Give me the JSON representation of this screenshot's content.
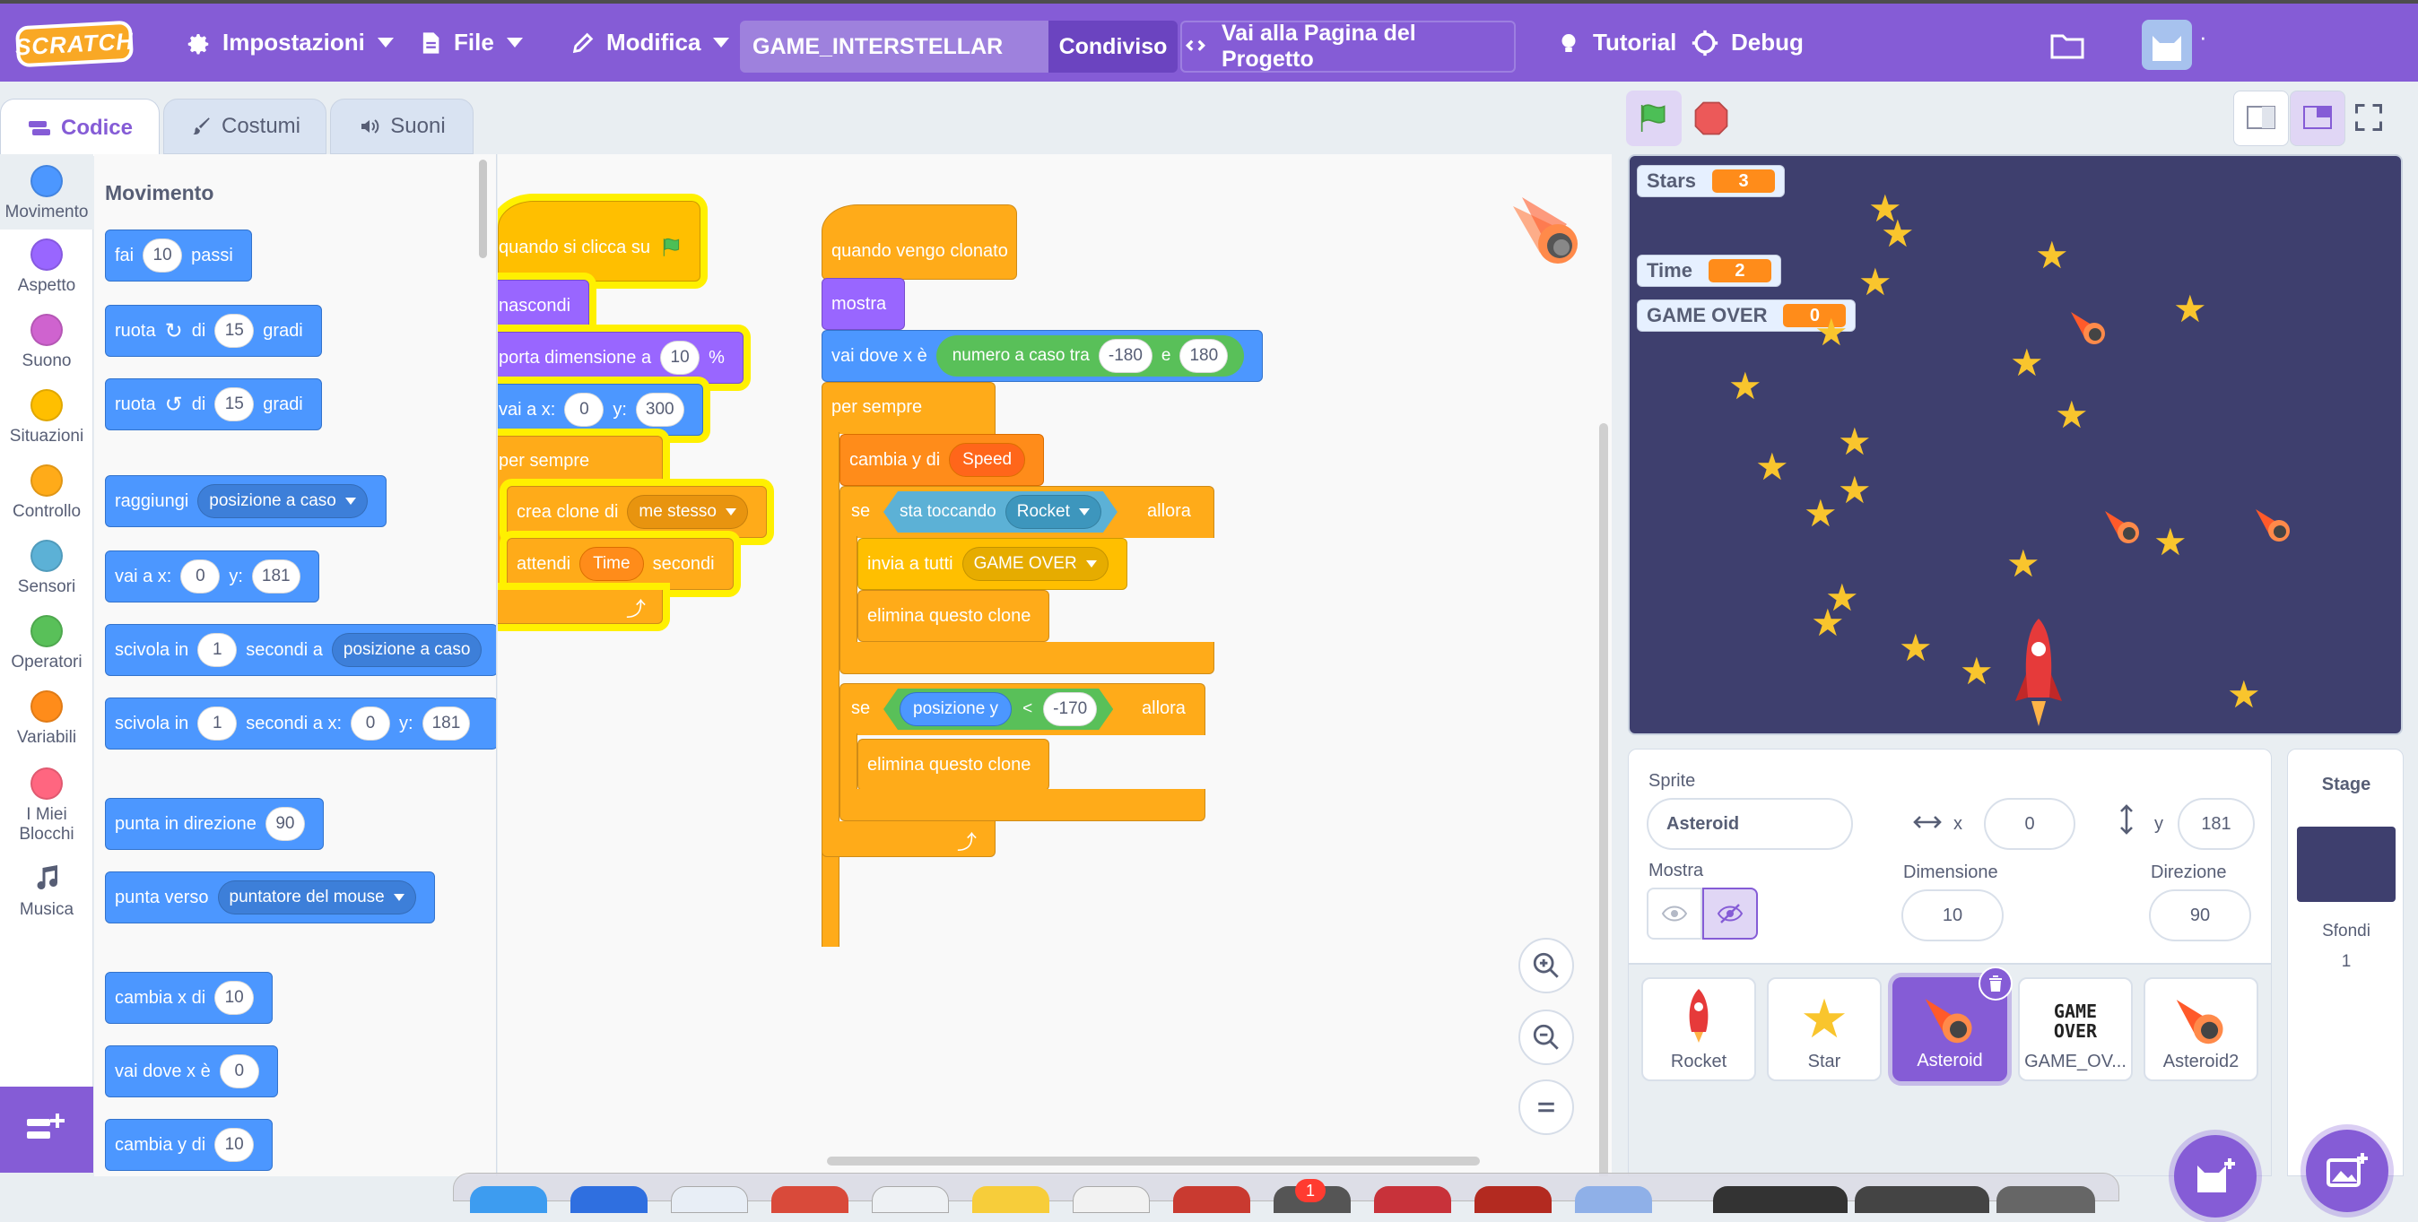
{
  "menubar": {
    "logo": "SCRATCH",
    "settings": "Impostazioni",
    "file": "File",
    "edit": "Modifica",
    "project_title": "GAME_INTERSTELLAR",
    "share": "Condiviso",
    "project_page": "Vai alla Pagina del Progetto",
    "tutorial": "Tutorial",
    "debug": "Debug",
    "dot": "·"
  },
  "tabs": {
    "code": "Codice",
    "costumes": "Costumi",
    "sounds": "Suoni"
  },
  "categories": [
    {
      "label": "Movimento",
      "color": "#4c97ff"
    },
    {
      "label": "Aspetto",
      "color": "#9966ff"
    },
    {
      "label": "Suono",
      "color": "#cf63cf"
    },
    {
      "label": "Situazioni",
      "color": "#ffbf00"
    },
    {
      "label": "Controllo",
      "color": "#ffab19"
    },
    {
      "label": "Sensori",
      "color": "#5cb1d6"
    },
    {
      "label": "Operatori",
      "color": "#59c059"
    },
    {
      "label": "Variabili",
      "color": "#ff8c1a"
    },
    {
      "label": "I Miei Blocchi",
      "color": "#ff6680"
    },
    {
      "label": "Musica",
      "color": ""
    }
  ],
  "palette": {
    "heading": "Movimento",
    "move": {
      "a": "fai",
      "n": "10",
      "b": "passi"
    },
    "turn_right": {
      "a": "ruota",
      "b": "di",
      "n": "15",
      "c": "gradi"
    },
    "turn_left": {
      "a": "ruota",
      "b": "di",
      "n": "15",
      "c": "gradi"
    },
    "goto_target": {
      "a": "raggiungi",
      "dd": "posizione a caso"
    },
    "goto_xy": {
      "a": "vai a x:",
      "x": "0",
      "b": "y:",
      "y": "181"
    },
    "glide_target": {
      "a": "scivola in",
      "n": "1",
      "b": "secondi a",
      "dd": "posizione a caso"
    },
    "glide_xy": {
      "a": "scivola in",
      "n": "1",
      "b": "secondi a x:",
      "x": "0",
      "c": "y:",
      "y": "181"
    },
    "point_dir": {
      "a": "punta in direzione",
      "n": "90"
    },
    "point_towards": {
      "a": "punta verso",
      "dd": "puntatore del mouse"
    },
    "change_x": {
      "a": "cambia x di",
      "n": "10"
    },
    "set_x": {
      "a": "vai dove x è",
      "n": "0"
    },
    "change_y": {
      "a": "cambia y di",
      "n": "10"
    }
  },
  "script1": {
    "hat": "quando si clicca su",
    "hide": "nascondi",
    "size": {
      "a": "porta dimensione a",
      "n": "10",
      "b": "%"
    },
    "goto": {
      "a": "vai a x:",
      "x": "0",
      "b": "y:",
      "y": "300"
    },
    "forever": "per sempre",
    "clone": {
      "a": "crea clone di",
      "dd": "me stesso"
    },
    "wait": {
      "a": "attendi",
      "var": "Time",
      "b": "secondi"
    }
  },
  "script2": {
    "hat": "quando vengo clonato",
    "show": "mostra",
    "setx": {
      "a": "vai dove x è",
      "op": "numero a caso tra",
      "n1": "-180",
      "e": "e",
      "n2": "180"
    },
    "forever": "per sempre",
    "changey": {
      "a": "cambia y di",
      "var": "Speed"
    },
    "if1": {
      "se": "se",
      "touch": "sta toccando",
      "dd": "Rocket",
      "then": "allora"
    },
    "broadcast": {
      "a": "invia a tutti",
      "dd": "GAME OVER"
    },
    "delete1": "elimina questo clone",
    "if2": {
      "se": "se",
      "var": "posizione y",
      "lt": "<",
      "n": "-170",
      "then": "allora"
    },
    "delete2": "elimina questo clone"
  },
  "stage": {
    "monitors": [
      {
        "name": "Stars",
        "value": "3"
      },
      {
        "name": "Time",
        "value": "2"
      },
      {
        "name": "GAME OVER",
        "value": "0"
      }
    ],
    "star_glyph": "★"
  },
  "sprite_info": {
    "sprite_label": "Sprite",
    "sprite_name": "Asteroid",
    "x_label": "x",
    "x": "0",
    "y_label": "y",
    "y": "181",
    "show_label": "Mostra",
    "size_label": "Dimensione",
    "size": "10",
    "dir_label": "Direzione",
    "dir": "90"
  },
  "sprites": [
    {
      "name": "Rocket",
      "selected": false
    },
    {
      "name": "Star",
      "selected": false
    },
    {
      "name": "Asteroid",
      "selected": true
    },
    {
      "name": "GAME_OV...",
      "selected": false
    },
    {
      "name": "Asteroid2",
      "selected": false
    }
  ],
  "game_over_thumb": [
    "GAME",
    "OVER"
  ],
  "stage_panel": {
    "title": "Stage",
    "backdrops_label": "Sfondi",
    "backdrops_count": "1"
  },
  "dock_badge": "1",
  "colors": {
    "accent": "#855cd6",
    "stage_bg": "#3e3f6e"
  }
}
